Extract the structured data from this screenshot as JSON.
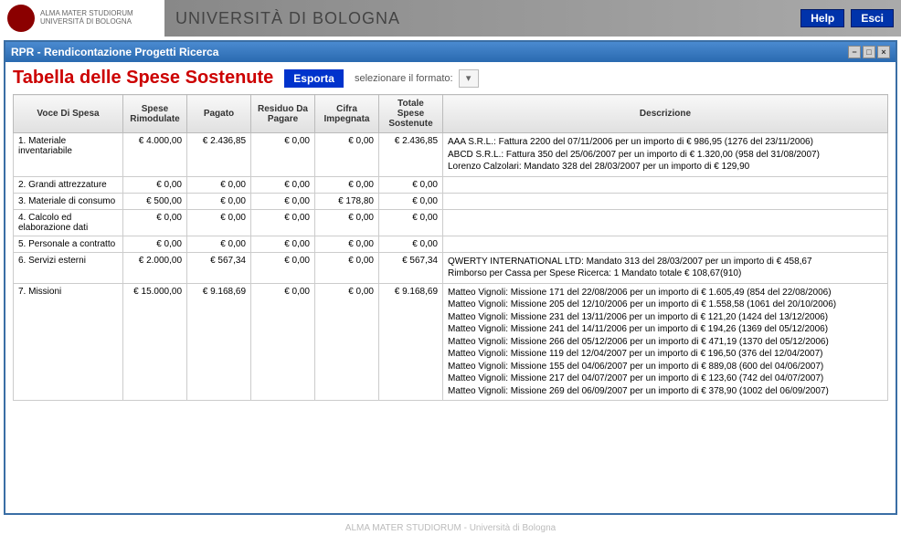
{
  "banner": {
    "logo_line1": "ALMA MATER STUDIORUM",
    "logo_line2": "UNIVERSITÀ DI BOLOGNA",
    "uni_name": "UNIVERSITÀ DI BOLOGNA",
    "help": "Help",
    "esci": "Esci"
  },
  "window": {
    "title": "RPR - Rendicontazione Progetti Ricerca"
  },
  "page": {
    "title": "Tabella delle Spese Sostenute",
    "export": "Esporta",
    "format_label": "selezionare il formato:"
  },
  "table": {
    "headers": {
      "voce": "Voce Di Spesa",
      "rimodulate": "Spese Rimodulate",
      "pagato": "Pagato",
      "residuo": "Residuo Da Pagare",
      "impegnata": "Cifra Impegnata",
      "totale": "Totale Spese Sostenute",
      "descrizione": "Descrizione"
    },
    "rows": [
      {
        "voce": "1. Materiale inventariabile",
        "rimodulate": "€ 4.000,00",
        "pagato": "€ 2.436,85",
        "residuo": "€ 0,00",
        "impegnata": "€ 0,00",
        "totale": "€ 2.436,85",
        "descrizione": "AAA S.R.L.: Fattura 2200 del 07/11/2006 per un importo di € 986,95 (1276 del 23/11/2006)\nABCD S.R.L.: Fattura 350 del 25/06/2007 per un importo di € 1.320,00 (958 del 31/08/2007)\nLorenzo Calzolari: Mandato 328 del 28/03/2007 per un importo di € 129,90"
      },
      {
        "voce": "2. Grandi attrezzature",
        "rimodulate": "€ 0,00",
        "pagato": "€ 0,00",
        "residuo": "€ 0,00",
        "impegnata": "€ 0,00",
        "totale": "€ 0,00",
        "descrizione": ""
      },
      {
        "voce": "3. Materiale di consumo",
        "rimodulate": "€ 500,00",
        "pagato": "€ 0,00",
        "residuo": "€ 0,00",
        "impegnata": "€ 178,80",
        "totale": "€ 0,00",
        "descrizione": ""
      },
      {
        "voce": "4. Calcolo ed elaborazione dati",
        "rimodulate": "€ 0,00",
        "pagato": "€ 0,00",
        "residuo": "€ 0,00",
        "impegnata": "€ 0,00",
        "totale": "€ 0,00",
        "descrizione": ""
      },
      {
        "voce": "5. Personale a contratto",
        "rimodulate": "€ 0,00",
        "pagato": "€ 0,00",
        "residuo": "€ 0,00",
        "impegnata": "€ 0,00",
        "totale": "€ 0,00",
        "descrizione": ""
      },
      {
        "voce": "6. Servizi esterni",
        "rimodulate": "€ 2.000,00",
        "pagato": "€ 567,34",
        "residuo": "€ 0,00",
        "impegnata": "€ 0,00",
        "totale": "€ 567,34",
        "descrizione": "QWERTY INTERNATIONAL LTD: Mandato 313 del 28/03/2007 per un importo di € 458,67\nRimborso per Cassa per Spese Ricerca: 1 Mandato totale € 108,67(910)"
      },
      {
        "voce": "7. Missioni",
        "rimodulate": "€ 15.000,00",
        "pagato": "€ 9.168,69",
        "residuo": "€ 0,00",
        "impegnata": "€ 0,00",
        "totale": "€ 9.168,69",
        "descrizione": "Matteo Vignoli: Missione 171 del 22/08/2006 per un importo di € 1.605,49 (854 del 22/08/2006)\nMatteo Vignoli: Missione 205 del 12/10/2006 per un importo di € 1.558,58 (1061 del 20/10/2006)\nMatteo Vignoli: Missione 231 del 13/11/2006 per un importo di € 121,20 (1424 del 13/12/2006)\nMatteo Vignoli: Missione 241 del 14/11/2006 per un importo di € 194,26 (1369 del 05/12/2006)\nMatteo Vignoli: Missione 266 del 05/12/2006 per un importo di € 471,19 (1370 del 05/12/2006)\nMatteo Vignoli: Missione 119 del 12/04/2007 per un importo di € 196,50 (376 del 12/04/2007)\nMatteo Vignoli: Missione 155 del 04/06/2007 per un importo di € 889,08 (600 del 04/06/2007)\nMatteo Vignoli: Missione 217 del 04/07/2007 per un importo di € 123,60 (742 del 04/07/2007)\nMatteo Vignoli: Missione 269 del 06/09/2007 per un importo di € 378,90 (1002 del 06/09/2007)"
      }
    ]
  },
  "footer": "ALMA MATER STUDIORUM - Università di Bologna"
}
